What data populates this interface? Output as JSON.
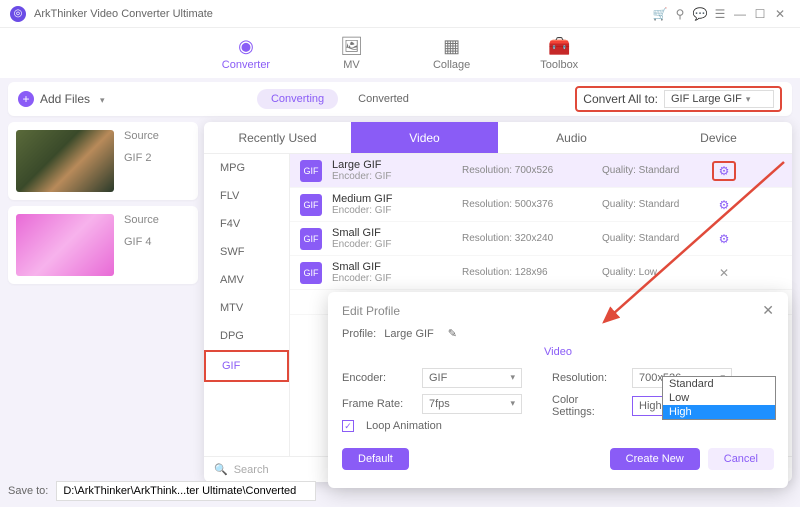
{
  "app": {
    "title": "ArkThinker Video Converter Ultimate"
  },
  "maintabs": {
    "converter": "Converter",
    "mv": "MV",
    "collage": "Collage",
    "toolbox": "Toolbox"
  },
  "toolbar": {
    "add_files": "Add Files",
    "converting": "Converting",
    "converted": "Converted",
    "convert_all_label": "Convert All to:",
    "convert_all_value": "GIF Large GIF"
  },
  "files": [
    {
      "source": "Source",
      "fmt_prefix": "GIF  2"
    },
    {
      "source": "Source",
      "fmt_prefix": "GIF  4"
    }
  ],
  "fp": {
    "tabs": {
      "recent": "Recently Used",
      "video": "Video",
      "audio": "Audio",
      "device": "Device"
    },
    "formats": [
      "MPG",
      "FLV",
      "F4V",
      "SWF",
      "AMV",
      "MTV",
      "DPG",
      "GIF"
    ],
    "presets": [
      {
        "name": "Large GIF",
        "enc": "Encoder: GIF",
        "res": "Resolution: 700x526",
        "q": "Quality: Standard",
        "act": "gear",
        "hl": true
      },
      {
        "name": "Medium GIF",
        "enc": "Encoder: GIF",
        "res": "Resolution: 500x376",
        "q": "Quality: Standard",
        "act": "gear",
        "hl": false
      },
      {
        "name": "Small GIF",
        "enc": "Encoder: GIF",
        "res": "Resolution: 320x240",
        "q": "Quality: Standard",
        "act": "gear",
        "hl": false
      },
      {
        "name": "Small GIF",
        "enc": "Encoder: GIF",
        "res": "Resolution: 128x96",
        "q": "Quality: Low",
        "act": "close",
        "hl": false
      }
    ],
    "search": "Search"
  },
  "edit": {
    "title": "Edit Profile",
    "profile_label": "Profile:",
    "profile_value": "Large GIF",
    "section": "Video",
    "encoder_label": "Encoder:",
    "encoder_value": "GIF",
    "framerate_label": "Frame Rate:",
    "framerate_value": "7fps",
    "resolution_label": "Resolution:",
    "resolution_value": "700x526",
    "colorset_label": "Color Settings:",
    "colorset_value": "High",
    "loop": "Loop Animation",
    "default": "Default",
    "create": "Create New",
    "cancel": "Cancel"
  },
  "dropdown": {
    "opts": [
      "Standard",
      "Low",
      "High"
    ],
    "selected": "High"
  },
  "footer": {
    "save_label": "Save to:",
    "path": "D:\\ArkThinker\\ArkThink...ter Ultimate\\Converted"
  }
}
